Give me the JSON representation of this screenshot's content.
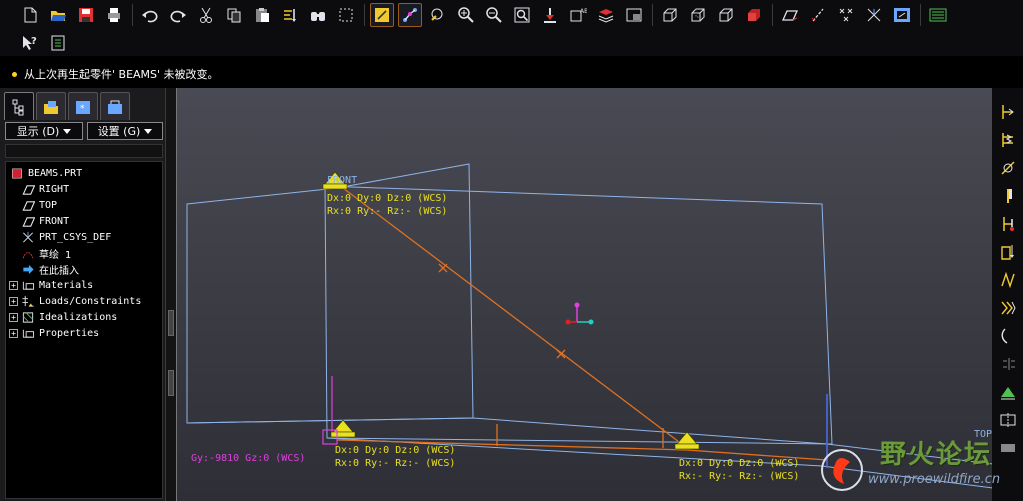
{
  "toolbar": {
    "row1": [
      {
        "name": "new-file-icon"
      },
      {
        "name": "open-file-icon"
      },
      {
        "name": "save-icon"
      },
      {
        "name": "print-icon"
      },
      {
        "sep": true
      },
      {
        "name": "undo-icon"
      },
      {
        "name": "redo-icon"
      },
      {
        "name": "cut-icon"
      },
      {
        "name": "copy-icon"
      },
      {
        "name": "paste-icon"
      },
      {
        "name": "regenerate-icon"
      },
      {
        "name": "find-icon"
      },
      {
        "name": "select-box-icon"
      },
      {
        "sep": true
      },
      {
        "name": "datum-display-icon",
        "active": true
      },
      {
        "name": "spin-center-icon",
        "active": true
      },
      {
        "name": "orient-icon"
      },
      {
        "name": "zoom-in-icon"
      },
      {
        "name": "zoom-out-icon"
      },
      {
        "name": "refit-icon"
      },
      {
        "name": "repaint-icon"
      },
      {
        "name": "saved-views-icon"
      },
      {
        "name": "layers-icon"
      },
      {
        "name": "view-manager-icon"
      },
      {
        "sep": true
      },
      {
        "name": "wireframe-icon"
      },
      {
        "name": "hidden-line-icon"
      },
      {
        "name": "no-hidden-icon"
      },
      {
        "name": "shading-icon"
      },
      {
        "sep": true
      },
      {
        "name": "datum-planes-icon"
      },
      {
        "name": "datum-axes-icon"
      },
      {
        "name": "datum-points-icon"
      },
      {
        "name": "coordinate-systems-icon"
      },
      {
        "name": "annotation-display-icon"
      },
      {
        "sep": true
      },
      {
        "name": "simulation-display-icon"
      }
    ],
    "row2": [
      {
        "name": "context-help-icon"
      },
      {
        "name": "model-info-icon"
      }
    ]
  },
  "message": {
    "text": "从上次再生起零件' BEAMS' 未被改变。"
  },
  "left_panel": {
    "tabs": [
      {
        "name": "model-tree-tab-icon",
        "selected": true
      },
      {
        "name": "folder-browser-tab-icon"
      },
      {
        "name": "favorites-tab-icon"
      },
      {
        "name": "connections-tab-icon"
      }
    ],
    "display_menu": "显示 (D)",
    "settings_menu": "设置 (G)",
    "tree": [
      {
        "label": "BEAMS.PRT",
        "icon": "part-icon",
        "expander": "",
        "indent": 0
      },
      {
        "label": "RIGHT",
        "icon": "datum-plane-icon",
        "expander": "",
        "indent": 1
      },
      {
        "label": "TOP",
        "icon": "datum-plane-icon",
        "expander": "",
        "indent": 1
      },
      {
        "label": "FRONT",
        "icon": "datum-plane-icon",
        "expander": "",
        "indent": 1
      },
      {
        "label": "PRT_CSYS_DEF",
        "icon": "csys-icon",
        "expander": "",
        "indent": 1
      },
      {
        "label": "草绘 1",
        "icon": "sketch-icon",
        "expander": "",
        "indent": 1
      },
      {
        "label": "在此插入",
        "icon": "insert-here-icon",
        "expander": "",
        "indent": 1
      },
      {
        "label": "Materials",
        "icon": "materials-icon",
        "expander": "+",
        "indent": 0
      },
      {
        "label": "Loads/Constraints",
        "icon": "loads-constraints-icon",
        "expander": "+",
        "indent": 0
      },
      {
        "label": "Idealizations",
        "icon": "idealizations-icon",
        "expander": "+",
        "indent": 0
      },
      {
        "label": "Properties",
        "icon": "properties-icon",
        "expander": "+",
        "indent": 0
      }
    ]
  },
  "graphics": {
    "labels": {
      "plane_front": "FRONT",
      "plane_top": "TOP",
      "c1_disp": "Dx:0  Dy:0  Dz:0  (WCS)",
      "c1_rot": "Rx:0  Ry:-  Rz:-  (WCS)",
      "c2_disp": "Dx:0  Dy:0  Dz:0  (WCS)",
      "c2_rot": "Rx:0  Ry:-  Rz:-  (WCS)",
      "c3_disp": "Dx:0  Dy:0  Dz:0  (WCS)",
      "c3_rot": "Rx:-  Ry:-  Rz:-  (WCS)",
      "gravity": "Gy:-9810  Gz:0  (WCS)"
    },
    "colors": {
      "plane": "#8fb4e8",
      "beam": "#e07020",
      "constraint_text": "#e8e020",
      "gravity_text": "#e040e0"
    }
  },
  "right_toolbar": [
    {
      "name": "beam-icon"
    },
    {
      "name": "spring-icon"
    },
    {
      "name": "mass-icon"
    },
    {
      "name": "shell-icon"
    },
    {
      "name": "temperature-load-icon"
    },
    {
      "name": "force-load-icon"
    },
    {
      "name": "pressure-icon"
    },
    {
      "name": "bearing-load-icon"
    },
    {
      "name": "gravity-icon"
    },
    {
      "name": "centrifugal-icon"
    },
    {
      "name": "displacement-constraint-icon"
    },
    {
      "name": "symmetry-constraint-icon"
    },
    {
      "name": "rigid-link-icon"
    }
  ],
  "watermark": {
    "title": "野火论坛",
    "url": "www.proewildfire.cn"
  }
}
